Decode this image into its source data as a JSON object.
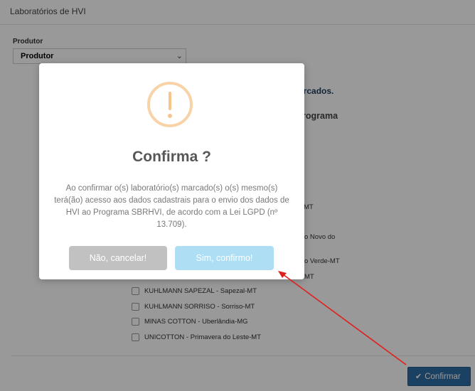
{
  "header": {
    "title": "Laboratórios de HVI"
  },
  "form": {
    "produtor_label": "Produtor",
    "produtor_value": "Produtor"
  },
  "background": {
    "marcados_text": "arcados.",
    "programa_text": "rograma",
    "fragments": [
      "MT",
      "o Novo do",
      "o Verde-MT",
      "MT"
    ]
  },
  "labs": [
    {
      "label": "KUHLMANN SAPEZAL - Sapezal-MT"
    },
    {
      "label": "KUHLMANN SORRISO - Sorriso-MT"
    },
    {
      "label": "MINAS COTTON - Uberlândia-MG"
    },
    {
      "label": "UNICOTTON - Primavera do Leste-MT"
    }
  ],
  "footer": {
    "confirm_label": "Confirmar"
  },
  "modal": {
    "title": "Confirma ?",
    "message": "Ao confirmar o(s) laboratório(s) marcado(s) o(s) mesmo(s) terá(ão) acesso aos dados cadastrais para o envio dos dados de HVI ao Programa SBRHVI, de acordo com a Lei LGPD (nº 13.709).",
    "cancel_label": "Não, cancelar!",
    "confirm_label": "Sim, confirmo!"
  },
  "colors": {
    "primary": "#2e6da4",
    "warning": "#f8bb86",
    "confirm": "#aedef4",
    "cancel": "#c1c1c1",
    "annotation_arrow": "#e0201c"
  },
  "icons": {
    "warning": "exclamation-circle-icon",
    "confirm": "check-icon",
    "select": "chevron-down-icon"
  }
}
